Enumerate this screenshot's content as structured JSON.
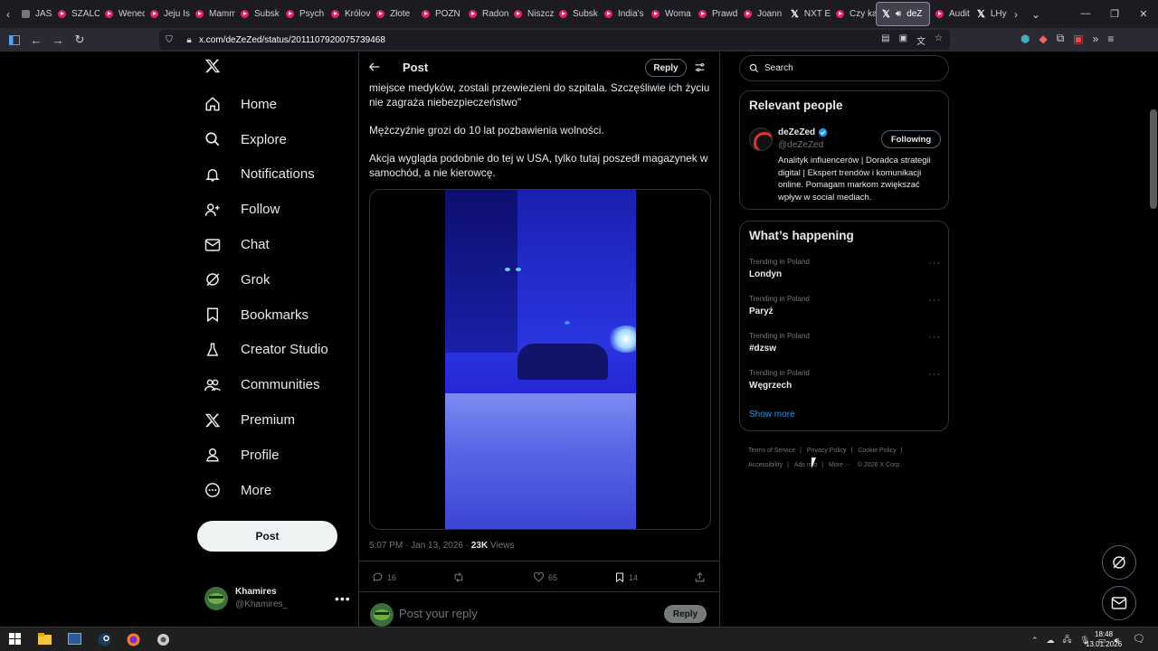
{
  "browser": {
    "tabs": [
      {
        "label": "JASZC",
        "favicon": "generic"
      },
      {
        "label": "SZALO",
        "favicon": "youtube"
      },
      {
        "label": "Wenec",
        "favicon": "youtube"
      },
      {
        "label": "Jeju Is",
        "favicon": "youtube"
      },
      {
        "label": "Mamm",
        "favicon": "youtube"
      },
      {
        "label": "Subsk",
        "favicon": "youtube"
      },
      {
        "label": "Psych",
        "favicon": "youtube"
      },
      {
        "label": "Królov",
        "favicon": "youtube"
      },
      {
        "label": "Złote",
        "favicon": "youtube"
      },
      {
        "label": "POZN",
        "favicon": "youtube"
      },
      {
        "label": "Radon",
        "favicon": "youtube"
      },
      {
        "label": "Niszcz",
        "favicon": "youtube"
      },
      {
        "label": "Subsk",
        "favicon": "youtube"
      },
      {
        "label": "India's",
        "favicon": "youtube"
      },
      {
        "label": "Woma",
        "favicon": "youtube"
      },
      {
        "label": "Prawd",
        "favicon": "youtube"
      },
      {
        "label": "Joann",
        "favicon": "youtube"
      },
      {
        "label": "NXT E",
        "favicon": "x"
      },
      {
        "label": "Czy ka",
        "favicon": "youtube"
      },
      {
        "label": "deZ",
        "favicon": "x",
        "active": true
      },
      {
        "label": "Audit",
        "favicon": "youtube"
      },
      {
        "label": "LHy",
        "favicon": "x"
      }
    ],
    "url": "x.com/deZeZed/status/2011107920075739468"
  },
  "sidebar": {
    "items": [
      {
        "label": "Home",
        "icon": "home-icon"
      },
      {
        "label": "Explore",
        "icon": "search-icon"
      },
      {
        "label": "Notifications",
        "icon": "bell-icon"
      },
      {
        "label": "Follow",
        "icon": "person-plus-icon"
      },
      {
        "label": "Chat",
        "icon": "mail-icon"
      },
      {
        "label": "Grok",
        "icon": "grok-icon"
      },
      {
        "label": "Bookmarks",
        "icon": "bookmark-icon"
      },
      {
        "label": "Creator Studio",
        "icon": "flask-icon"
      },
      {
        "label": "Communities",
        "icon": "people-icon"
      },
      {
        "label": "Premium",
        "icon": "x-logo-icon"
      },
      {
        "label": "Profile",
        "icon": "person-icon"
      },
      {
        "label": "More",
        "icon": "more-circle-icon"
      }
    ],
    "post_label": "Post",
    "account": {
      "name": "Khamires",
      "handle": "@Khamires_"
    }
  },
  "post": {
    "header_title": "Post",
    "reply_label": "Reply",
    "paragraphs": [
      "miejsce medyków, zostali przewiezieni do szpitala. Szczęśliwie ich życiu nie zagraża niebezpieczeństwo\"",
      "Mężczyźnie grozi do 10 lat pozbawienia wolności.",
      "Akcja wygląda podobnie do tej w USA, tylko tutaj poszedł magazynek w samochód, a nie kierowcę."
    ],
    "timestamp": "5:07 PM · Jan 13, 2026 · ",
    "views_count": "23K",
    "views_label": " Views",
    "stats": {
      "replies": "16",
      "reposts": "",
      "likes": "65",
      "bookmarks": "14"
    },
    "reply_placeholder": "Post your reply",
    "reply_button": "Reply"
  },
  "right": {
    "search_placeholder": "Search",
    "relevant_title": "Relevant people",
    "person": {
      "name": "deZeZed",
      "handle": "@deZeZed",
      "follow_label": "Following",
      "bio": "Analityk influencerów | Doradca strategii digital | Ekspert trendów i komunikacji online. Pomagam markom zwiększać wpływ w social mediach."
    },
    "happening_title": "What’s happening",
    "trends": [
      {
        "context": "Trending in Poland",
        "name": "Londyn"
      },
      {
        "context": "Trending in Poland",
        "name": "Paryż"
      },
      {
        "context": "Trending in Poland",
        "name": "#dzsw"
      },
      {
        "context": "Trending in Poland",
        "name": "Węgrzech"
      }
    ],
    "show_more": "Show more",
    "footer": [
      "Terms of Service",
      "Privacy Policy",
      "Cookie Policy",
      "Accessibility",
      "Ads info",
      "More ···",
      "© 2026 X Corp."
    ]
  },
  "taskbar": {
    "time": "18:48",
    "date": "13.01.2026"
  },
  "colors": {
    "accent": "#1d9bf0",
    "verified": "#1d9bf0",
    "youtube": "#e0245e"
  }
}
